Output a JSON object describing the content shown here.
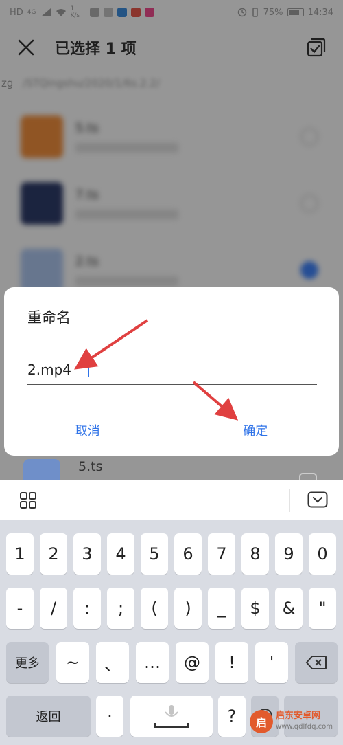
{
  "status_bar": {
    "net_type": "HD",
    "signal": "4G",
    "speed": "1 K/s",
    "battery": "75%",
    "time": "14:34"
  },
  "header": {
    "title": "已选择 1 项"
  },
  "breadcrumb": {
    "left": "zg",
    "path": "/STQingshu/2020/1/6s.2.2/"
  },
  "files": [
    {
      "name": "5.ts",
      "thumb_color": "#e98a3b",
      "checked": false
    },
    {
      "name": "7.ts",
      "thumb_color": "#2d3a66",
      "checked": false
    },
    {
      "name": "2.ts",
      "thumb_color": "#a7bfe6",
      "checked": true
    },
    {
      "name": "5.ts",
      "thumb_color": "#6f8fc9",
      "checked": false
    }
  ],
  "dialog": {
    "title": "重命名",
    "input_value": "2.mp4",
    "cancel_label": "取消",
    "confirm_label": "确定"
  },
  "keyboard": {
    "row1": [
      "1",
      "2",
      "3",
      "4",
      "5",
      "6",
      "7",
      "8",
      "9",
      "0"
    ],
    "row2": [
      "-",
      "/",
      ":",
      ";",
      "(",
      ")",
      "_",
      "$",
      "&",
      "\""
    ],
    "row3": [
      "~",
      "、",
      "…",
      "@",
      "!",
      "'"
    ],
    "more_label": "更多",
    "back_label": "返回",
    "dot_label": "·",
    "question_label": "?"
  },
  "watermark": {
    "title": "启东安卓网",
    "url": "www.qdlfdq.com"
  },
  "colors": {
    "accent": "#2f73e8",
    "arrow": "#e04040"
  }
}
